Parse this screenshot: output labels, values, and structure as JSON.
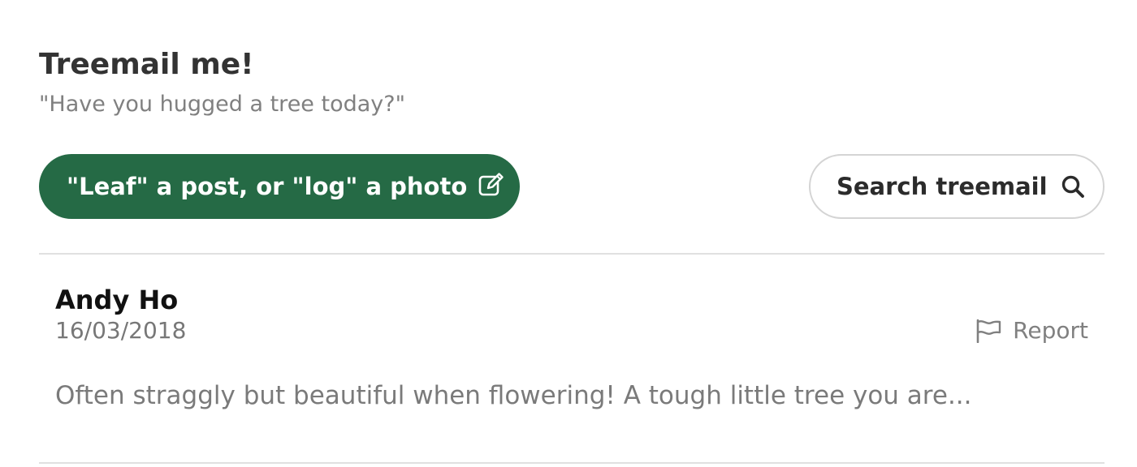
{
  "header": {
    "title": "Treemail me!",
    "subtitle": "\"Have you hugged a tree today?\""
  },
  "actions": {
    "post_label": "\"Leaf\" a post, or \"log\" a photo",
    "post_icon": "edit-icon",
    "search_label": "Search treemail",
    "search_icon": "search-icon"
  },
  "posts": [
    {
      "author": "Andy Ho",
      "date": "16/03/2018",
      "report_label": "Report",
      "report_icon": "flag-icon",
      "text": "Often straggly but beautiful when flowering! A tough little tree you are..."
    }
  ],
  "colors": {
    "primary_green": "#256a45",
    "border_gray": "#d4d4d4",
    "text_dark": "#333333",
    "text_muted": "#808080"
  }
}
